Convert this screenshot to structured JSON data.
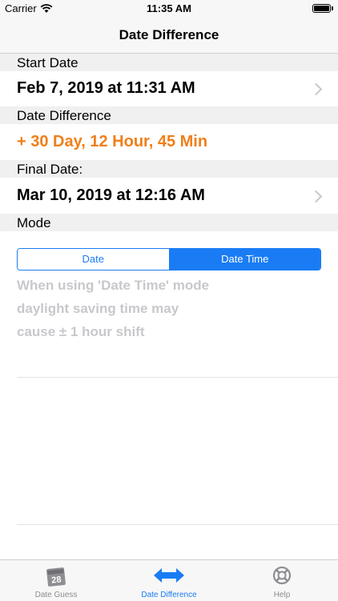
{
  "status": {
    "carrier": "Carrier",
    "time": "11:35 AM"
  },
  "nav": {
    "title": "Date Difference"
  },
  "start": {
    "header": "Start Date",
    "value": "Feb 7, 2019 at 11:31 AM"
  },
  "difference": {
    "header": "Date Difference",
    "value": "+ 30 Day, 12 Hour, 45 Min",
    "color": "#f07f1a"
  },
  "final": {
    "header": "Final Date:",
    "value": "Mar 10, 2019 at 12:16 AM"
  },
  "mode": {
    "header": "Mode",
    "options": [
      "Date",
      "Date Time"
    ],
    "selected": "Date Time",
    "note_lines": [
      "When using  'Date Time' mode",
      "daylight saving time may",
      "cause ± 1 hour shift"
    ]
  },
  "tabs": [
    {
      "label": "Date Guess",
      "icon": "calendar-icon",
      "calendar_day": "28",
      "active": false
    },
    {
      "label": "Date Difference",
      "icon": "double-arrow-icon",
      "active": true
    },
    {
      "label": "Help",
      "icon": "lifebuoy-icon",
      "active": false
    }
  ],
  "colors": {
    "accent": "#1a7cf5",
    "tab_inactive": "#8e8e93",
    "note": "#c8c8cc"
  }
}
